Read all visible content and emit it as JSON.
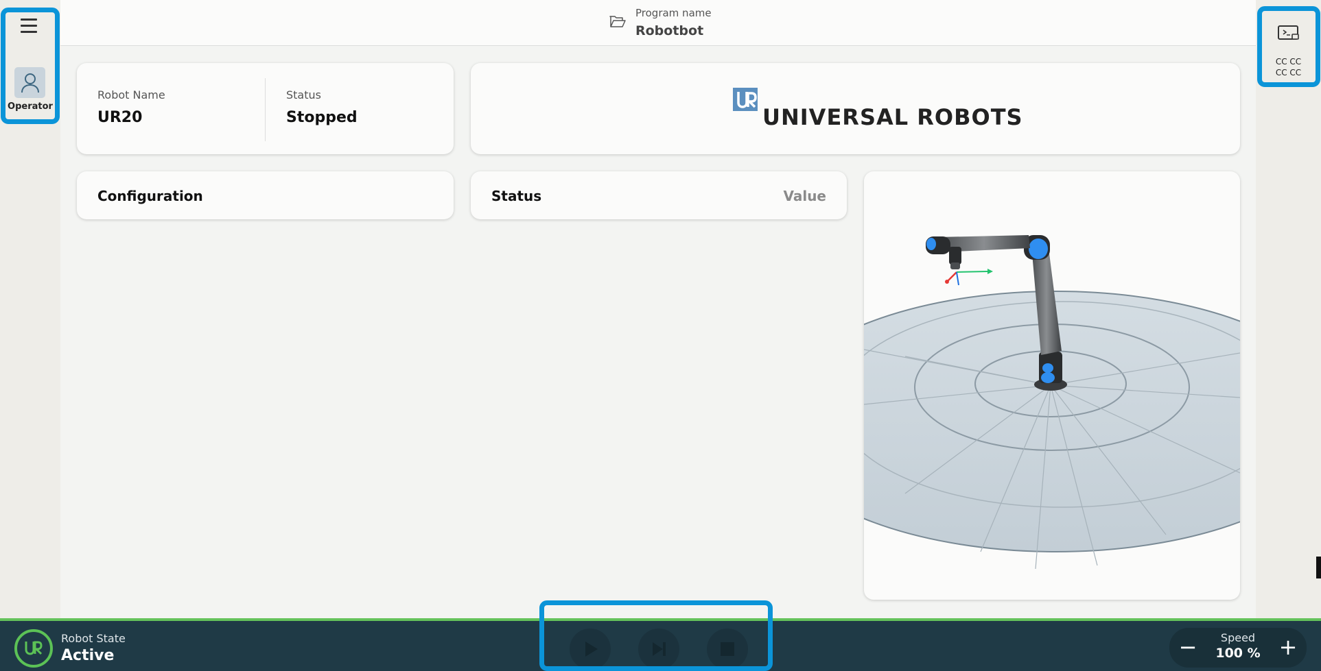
{
  "left_rail": {
    "menu_icon": "hamburger-menu-icon",
    "operator_icon": "user-icon",
    "operator_label": "Operator"
  },
  "right_rail": {
    "screen_icon": "remote-screen-icon",
    "cc_text": "CC CC\nCC CC"
  },
  "header": {
    "folder_icon": "folder-open-icon",
    "program_label": "Program name",
    "program_name": "Robotbot"
  },
  "robot_card": {
    "name_label": "Robot Name",
    "name_value": "UR20",
    "status_label": "Status",
    "status_value": "Stopped"
  },
  "logo": {
    "text": "UNIVERSAL ROBOTS",
    "mark": "UR"
  },
  "config_card": {
    "title": "Configuration"
  },
  "status_card": {
    "title": "Status",
    "value_header": "Value"
  },
  "bottom_bar": {
    "robot_state_label": "Robot State",
    "robot_state_value": "Active",
    "controls": [
      "play-icon",
      "step-forward-icon",
      "stop-icon"
    ],
    "speed_label": "Speed",
    "speed_value": "100 %"
  },
  "colors": {
    "accent_blue": "#0b94d8",
    "bar_bg": "#1f3a46",
    "active_green": "#5cc256",
    "joint_blue": "#2f8ef0"
  }
}
